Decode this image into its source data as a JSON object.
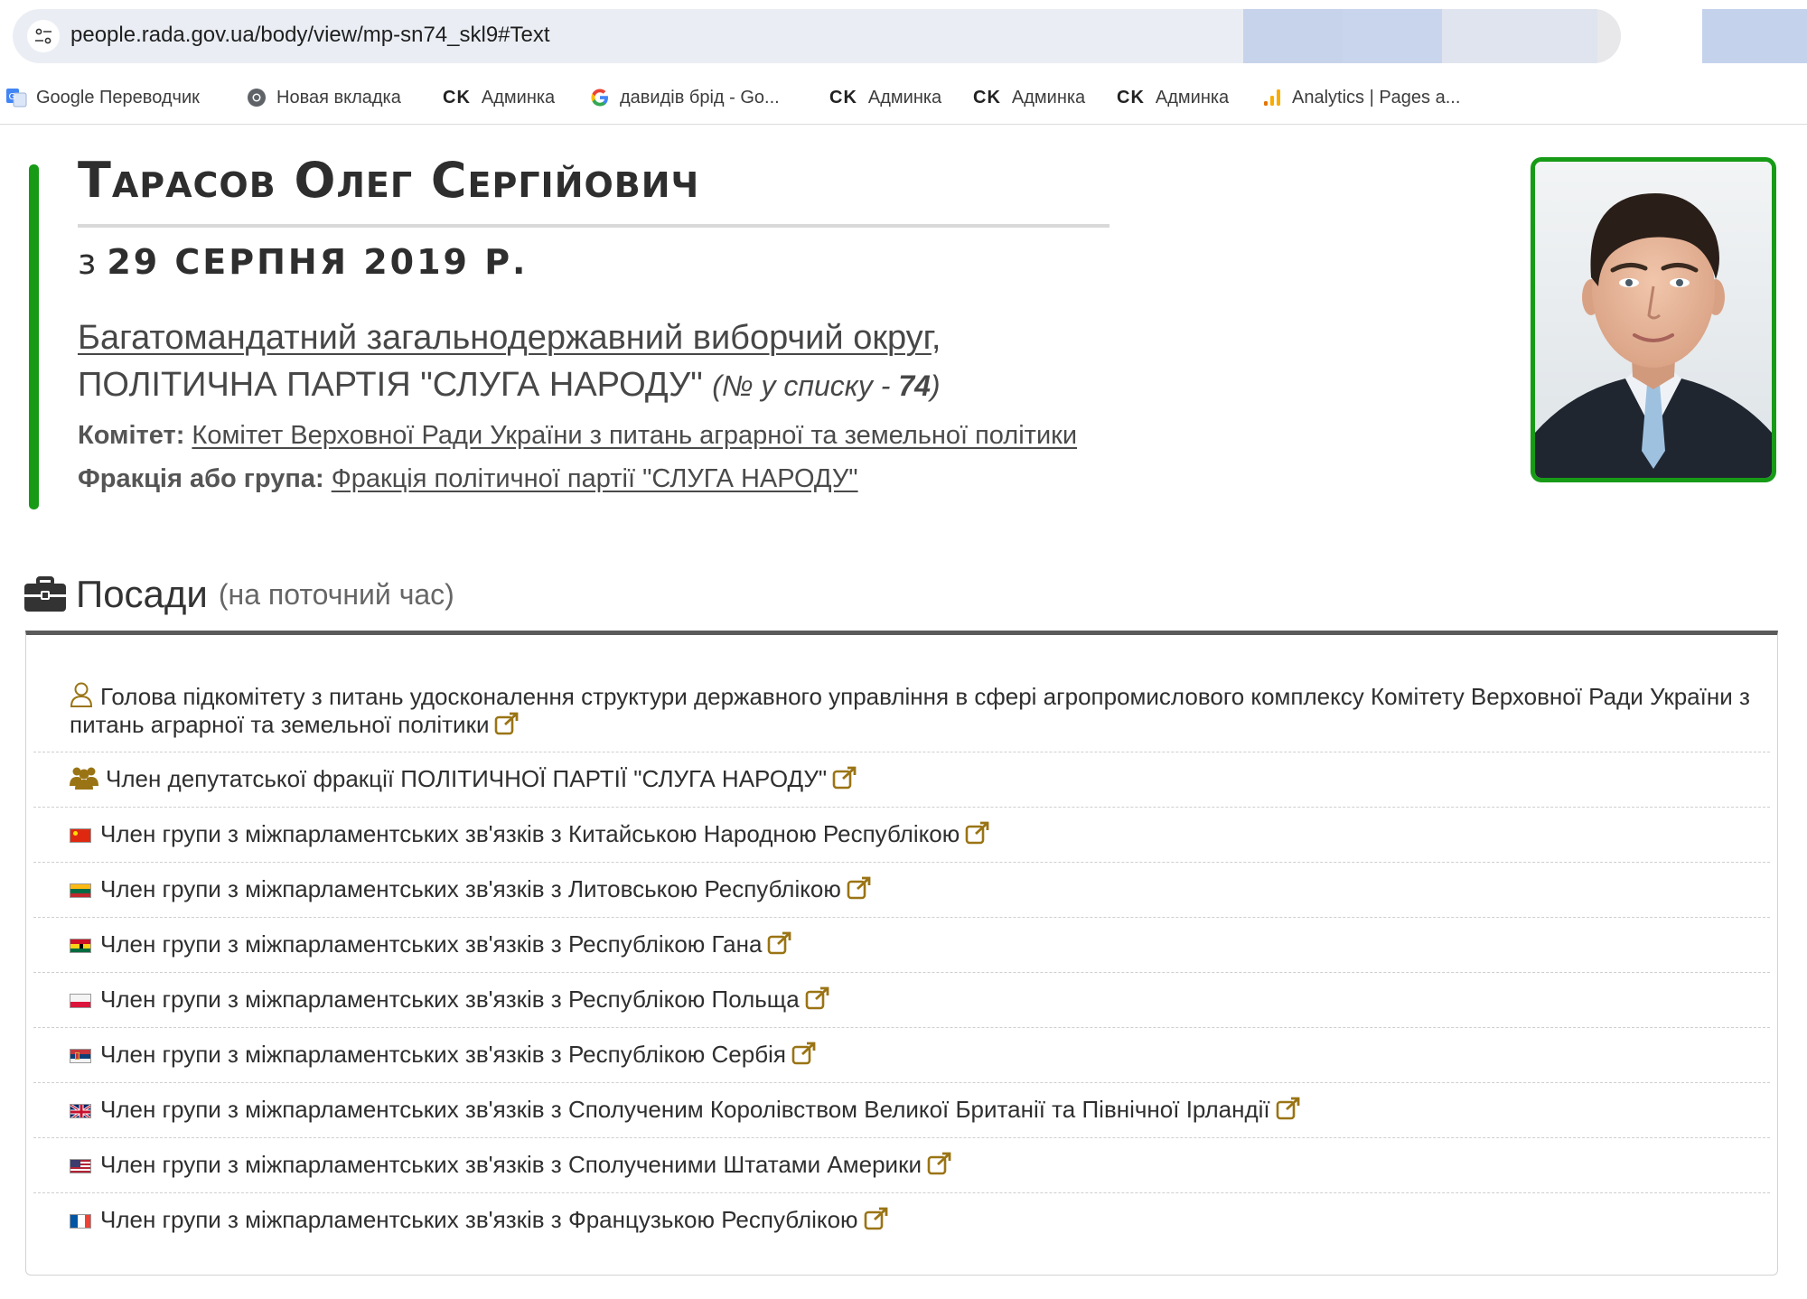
{
  "browser": {
    "url": "people.rada.gov.ua/body/view/mp-sn74_skl9#Text",
    "bookmarks": [
      {
        "label": "Google Переводчик",
        "icon": "google-translate-icon"
      },
      {
        "label": "Новая вкладка",
        "icon": "chrome-icon"
      },
      {
        "label": "Админка",
        "prefix": "CK"
      },
      {
        "label": "давидів брід - Go...",
        "icon": "google-icon"
      },
      {
        "label": "Админка",
        "prefix": "CK"
      },
      {
        "label": "Админка",
        "prefix": "CK"
      },
      {
        "label": "Админка",
        "prefix": "CK"
      },
      {
        "label": "Analytics | Pages a...",
        "icon": "analytics-icon"
      }
    ]
  },
  "profile": {
    "name": "Тарасов Олег Сергійович",
    "since_prefix": "з",
    "since_date": "29 серпня 2019 р.",
    "district_link": "Багатомандатний загальнодержавний виборчий округ",
    "district_comma": ",",
    "party": "ПОЛІТИЧНА ПАРТІЯ \"СЛУГА НАРОДУ\"",
    "list_label": "(№ у списку - ",
    "list_number": "74",
    "list_close": ")",
    "committee_label": "Комітет:",
    "committee_value": "Комітет Верховної Ради України з питань аграрної та земельної політики",
    "faction_label": "Фракція або група:",
    "faction_value": "Фракція політичної партії \"СЛУГА НАРОДУ\"",
    "accent_color": "#179b17"
  },
  "positions": {
    "title": "Посади",
    "subtitle": "(на поточний час)",
    "items": [
      {
        "icon": "user-outline-icon",
        "text": "Голова підкомітету з питань удосконалення структури державного управління в сфері агропромислового комплексу Комітету Верховної Ради України з питань аграрної та земельної політики"
      },
      {
        "icon": "group-icon",
        "text": "Член депутатської фракції ПОЛІТИЧНОЇ ПАРТІЇ \"СЛУГА НАРОДУ\""
      },
      {
        "icon": "flag-china-icon",
        "text": "Член групи з міжпарламентських зв'язків з Китайською Народною Республікою"
      },
      {
        "icon": "flag-lithuania-icon",
        "text": "Член групи з міжпарламентських зв'язків з Литовською Республікою"
      },
      {
        "icon": "flag-ghana-icon",
        "text": "Член групи з міжпарламентських зв'язків з Республікою Гана"
      },
      {
        "icon": "flag-poland-icon",
        "text": "Член групи з міжпарламентських зв'язків з Республікою Польща"
      },
      {
        "icon": "flag-serbia-icon",
        "text": "Член групи з міжпарламентських зв'язків з Республікою Сербія"
      },
      {
        "icon": "flag-uk-icon",
        "text": "Член групи з міжпарламентських зв'язків з Сполученим Королівством Великої Британії та Північної Ірландії"
      },
      {
        "icon": "flag-usa-icon",
        "text": "Член групи з міжпарламентських зв'язків з Сполученими Штатами Америки"
      },
      {
        "icon": "flag-france-icon",
        "text": "Член групи з міжпарламентських зв'язків з Французькою Республікою"
      }
    ],
    "link_color": "#9a7414"
  }
}
